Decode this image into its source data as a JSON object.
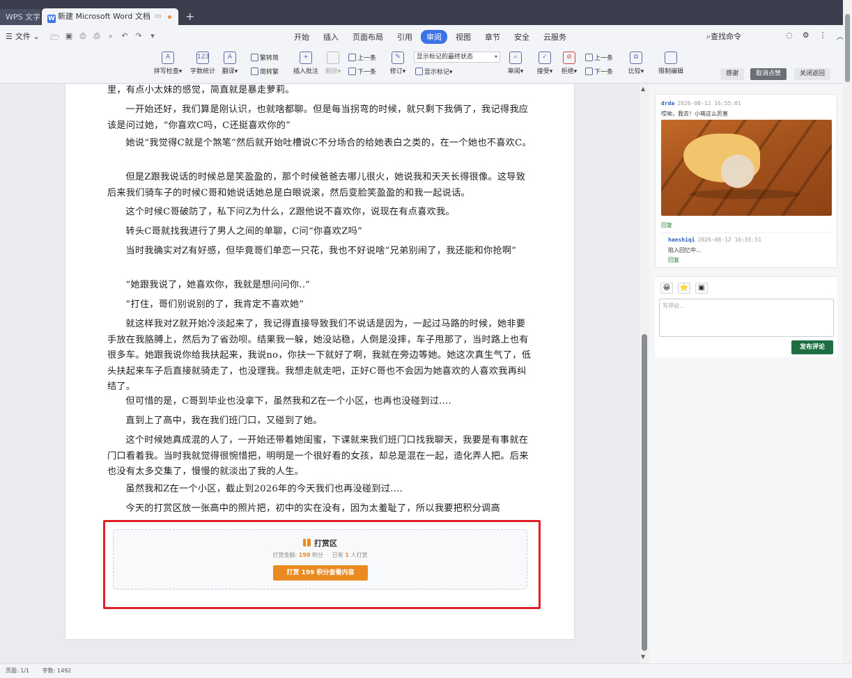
{
  "tabs": {
    "app_label": "WPS 文字",
    "doc_label": "新建 Microsoft Word 文档",
    "new_tab": "+"
  },
  "menu": {
    "file_label": "文件",
    "tabs": [
      "开始",
      "插入",
      "页面布局",
      "引用",
      "审阅",
      "视图",
      "章节",
      "安全",
      "云服务"
    ],
    "active_tab": "审阅",
    "search_label": "查找命令"
  },
  "ribbon": {
    "spell_check": "拼写检查",
    "word_count": "字数统计",
    "translate": "翻译",
    "trad_to_simp": "繁转简",
    "simp_to_trad": "简转繁",
    "insert_comment": "插入批注",
    "delete": "删除",
    "prev_comment": "上一条",
    "next_comment": "下一条",
    "track_changes": "修订",
    "markup_select": "显示标记的最终状态",
    "show_markup": "显示标记",
    "review_pane": "审阅",
    "accept": "接受",
    "reject": "拒绝",
    "prev_change": "上一条",
    "next_change": "下一条",
    "compare": "比较",
    "restrict_edit": "限制编辑",
    "thanks_btn": "感谢",
    "cancel_like_btn": "取消点赞",
    "close_return_btn": "关闭返回"
  },
  "document": {
    "paragraphs": [
      "里，有点小太妹的感觉，简直就是暴走萝莉。",
      "一开始还好，我们算是刚认识，也就啥都聊。但是每当拐弯的时候，就只剩下我俩了，我记得我应该是问过她，“你喜欢C吗，C还挺喜欢你的”",
      "她说“我觉得C就是个煞笔”然后就开始吐槽说C不分场合的给她表白之类的，在一个她也不喜欢C。",
      "但是Z跟我说话的时候总是笑盈盈的，那个时候爸爸去哪儿很火，她说我和天天长得很像。这导致后来我们骑车子的时候C哥和她说话她总是白眼说滚，然后变脸笑盈盈的和我一起说话。",
      "这个时候C哥破防了，私下问Z为什么，Z跟他说不喜欢你，说现在有点喜欢我。",
      "转头C哥就找我进行了男人之间的单聊，C问“你喜欢Z吗”",
      "当时我确实对Z有好感，但毕竟哥们单恋一只花，我也不好说啥“兄弟别闹了，我还能和你抢啊”",
      "“她跟我说了，她喜欢你，我就是想问问你..”",
      "“打住，哥们别说别的了，我肯定不喜欢她”",
      "就这样我对Z就开始冷淡起来了，我记得直接导致我们不说话是因为，一起过马路的时候，她非要手放在我胳膊上，然后为了省劲呗。结果我一躲，她没站稳，人倒是没摔，车子甩那了，当时路上也有很多车。她跟我说你给我扶起来，我说no，你扶一下就好了啊，我就在旁边等她。她这次真生气了，低头扶起来车子后直接就骑走了，也没理我。我想走就走吧，正好C哥也不会因为她喜欢的人喜欢我再纠结了。",
      "但可惜的是，C哥到毕业也没拿下，虽然我和Z在一个小区，也再也没碰到过....",
      "直到上了高中，我在我们班门口，又碰到了她。",
      "这个时候她真成混的人了，一开始还带着她闺蜜，下课就来我们班门口找我聊天，我要是有事就在门口看着我。当时我就觉得很惋惜把，明明是一个很好看的女孩，却总是混在一起，造化弄人把。后来也没有太多交集了，慢慢的就淡出了我的人生。",
      "虽然我和Z在一个小区，截止到2026年的今天我们也再没碰到过....",
      "今天的打赏区放一张高中的照片把，初中的实在没有，因为太羞耻了，所以我要把积分调高"
    ],
    "reward": {
      "title": "打赏区",
      "meta_prefix": "打赏金额:",
      "amount": "199",
      "meta_unit": "积分",
      "meta_sep": "·",
      "meta_count_prefix": "已有",
      "count": "1",
      "meta_count_suffix": "人打赏",
      "button": "打赏 199 积分查看内容"
    }
  },
  "comments": {
    "first": {
      "author": "drda",
      "time": "2026-08-12 16:55:01",
      "text": "哎呦，我去！小萌这么厉害",
      "reply": "回复"
    },
    "second": {
      "author": "hanshiqi",
      "time": "2026-08-12 16:55:51",
      "text": "陷入回忆中...",
      "reply": "回复"
    },
    "composer": {
      "placeholder": "写评论...",
      "post_button": "发布评论",
      "emoji_icons": [
        "😀",
        "⭐",
        "▣"
      ]
    }
  },
  "status": {
    "page": "页面: 1/1",
    "words": "字数: 1492"
  },
  "colors": {
    "accent_blue": "#3b74e6",
    "reward_orange": "#e98b20",
    "highlight_red": "#e21e26",
    "post_green": "#1d6e43"
  }
}
